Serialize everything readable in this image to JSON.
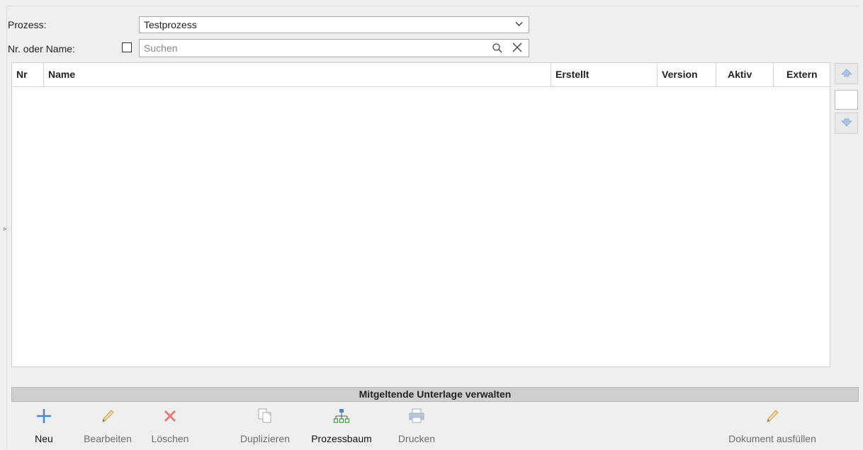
{
  "form": {
    "prozess_label": "Prozess:",
    "prozess_value": "Testprozess",
    "filter_label": "Nr. oder Name:",
    "search_placeholder": "Suchen"
  },
  "table": {
    "columns": [
      "Nr",
      "Name",
      "Erstellt",
      "Version",
      "Aktiv",
      "Extern"
    ],
    "rows": []
  },
  "section": {
    "title": "Mitgeltende Unterlage verwalten"
  },
  "toolbar": {
    "neu": "Neu",
    "bearbeiten": "Bearbeiten",
    "loeschen": "Löschen",
    "duplizieren": "Duplizieren",
    "prozessbaum": "Prozessbaum",
    "drucken": "Drucken",
    "dokument_ausfuellen": "Dokument ausfüllen"
  },
  "icons": {
    "neu": "plus-icon",
    "bearbeiten": "pencil-icon",
    "loeschen": "x-icon",
    "duplizieren": "copy-icon",
    "prozessbaum": "tree-icon",
    "drucken": "printer-icon",
    "dokument_ausfuellen": "pencil-icon",
    "up": "arrow-up-icon",
    "down": "arrow-down-icon"
  },
  "colors": {
    "accent_blue": "#4a86c8",
    "delete_red": "#e05555",
    "section_bar": "#cfcfcf"
  }
}
